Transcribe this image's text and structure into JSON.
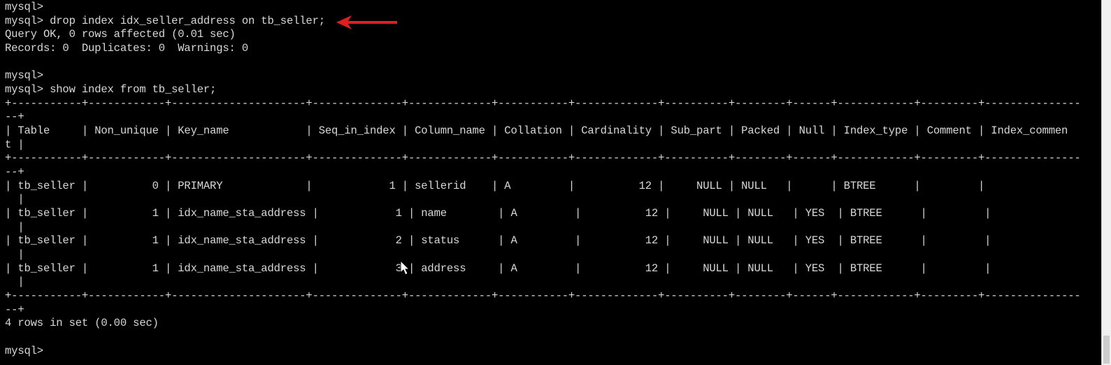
{
  "terminal": {
    "lines": [
      "mysql>",
      "mysql> drop index idx_seller_address on tb_seller;",
      "Query OK, 0 rows affected (0.01 sec)",
      "Records: 0  Duplicates: 0  Warnings: 0",
      "",
      "mysql>",
      "mysql> show index from tb_seller;",
      "+-----------+------------+---------------------+--------------+-------------+-----------+-------------+----------+--------+------+------------+---------+---------------",
      "--+",
      "| Table     | Non_unique | Key_name            | Seq_in_index | Column_name | Collation | Cardinality | Sub_part | Packed | Null | Index_type | Comment | Index_commen",
      "t |",
      "+-----------+------------+---------------------+--------------+-------------+-----------+-------------+----------+--------+------+------------+---------+---------------",
      "--+",
      "| tb_seller |          0 | PRIMARY             |            1 | sellerid    | A         |          12 |     NULL | NULL   |      | BTREE      |         |",
      "  |",
      "| tb_seller |          1 | idx_name_sta_address |            1 | name        | A         |          12 |     NULL | NULL   | YES  | BTREE      |         |",
      "  |",
      "| tb_seller |          1 | idx_name_sta_address |            2 | status      | A         |          12 |     NULL | NULL   | YES  | BTREE      |         |",
      "  |",
      "| tb_seller |          1 | idx_name_sta_address |            3 | address     | A         |          12 |     NULL | NULL   | YES  | BTREE      |         |",
      "  |",
      "+-----------+------------+---------------------+--------------+-------------+-----------+-------------+----------+--------+------+------------+---------+---------------",
      "--+",
      "4 rows in set (0.00 sec)",
      "",
      "mysql>"
    ]
  },
  "colors": {
    "background": "#000000",
    "text": "#d8d8d8",
    "arrow": "#e02020",
    "cursor": "#ffffff",
    "scrollbar": "#f0f0f0"
  },
  "icons": {
    "annotation": "red-arrow-icon",
    "pointer": "mouse-pointer-icon"
  }
}
